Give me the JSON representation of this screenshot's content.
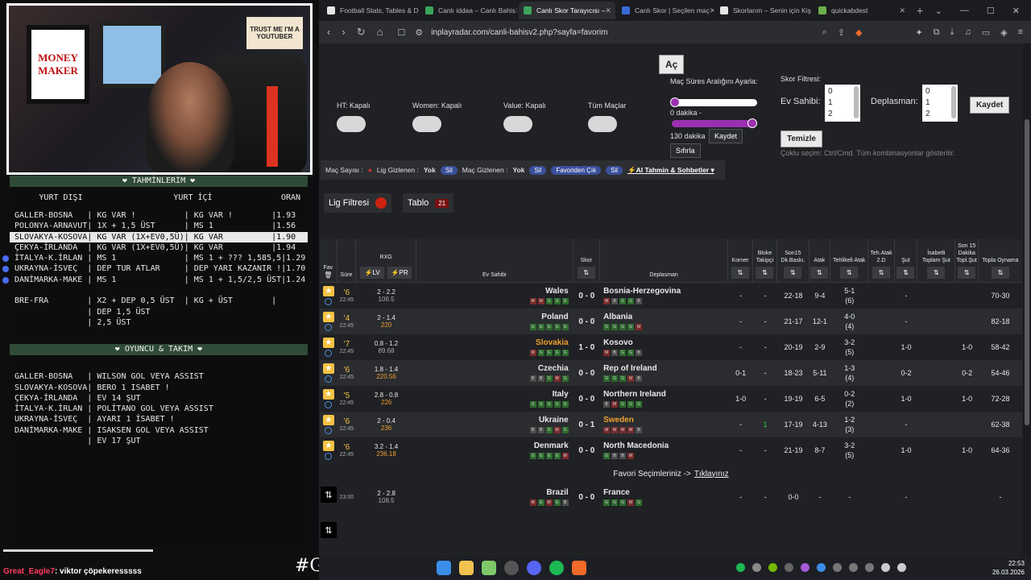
{
  "stream": {
    "poster_text": "MONEY MAKER",
    "sign_text": "TRUST ME I'M A YOUTUBER",
    "section1_title": "TAHMİNLERİM",
    "col_headers": [
      "YURT DIŞI",
      "YURT İÇİ",
      "ORAN"
    ],
    "predictions": [
      "GALLER-BOSNA   | KG VAR !          | KG VAR !        |1.93",
      "POLONYA-ARNAVUT| 1X + 1,5 ÜST      | MS 1            |1.56",
      "SLOVAKYA-KOSOVA| KG VAR (1X+EV0,5Ü)| KG VAR          |1.90",
      "ÇEKYA-İRLANDA  | KG VAR (1X+EV0,5Ü)| KG VAR          |1.94",
      "İTALYA-K.İRLAN | MS 1              | MS 1 + ??? 1,585,5|1.29",
      "UKRAYNA-İSVEÇ  | DEP TUR ATLAR     | DEP YARI KAZANIR !|1.70",
      "DANİMARKA-MAKE | MS 1              | MS 1 + 1,5/2,5 ÜST|1.24",
      "",
      "BRE-FRA        | X2 + DEP 0,5 ÜST  | KG + ÜST        |",
      "               | DEP 1,5 ÜST",
      "               | 2,5 ÜST"
    ],
    "section2_title": "OYUNCU & TAKIM",
    "player_props": [
      "GALLER-BOSNA   | WILSON GOL VEYA ASSIST",
      "SLOVAKYA-KOSOVA| BERO 1 ISABET !",
      "ÇEKYA-İRLANDA  | EV 14 ŞUT",
      "İTALYA-K.İRLAN | POLİTANO GOL VEYA ASSIST",
      "UKRAYNA-İSVEÇ  | AYARI 1 İSABET !",
      "DANİMARKA-MAKE | ISAKSEN GOL VEYA ASSIST",
      "               | EV 17 ŞUT"
    ],
    "chat_user": "Great_Eagle7",
    "chat_msg": ": viktor çöpekeresssss",
    "hashtag": "#GollerNerede"
  },
  "tabs": [
    {
      "label": "Football Stats, Tables & D",
      "color": "#e7e7e7"
    },
    {
      "label": "Canlı iddaa – Canlı Bahis",
      "color": "#3aa55a"
    },
    {
      "label": "Canlı Skor Tarayıcısı –",
      "color": "#3aa55a"
    },
    {
      "label": "Canlı Skor | Seçilen maç",
      "color": "#3a6ad8"
    },
    {
      "label": "Skorlarım – Senin için Kiş",
      "color": "#e7e7e7"
    },
    {
      "label": "quickabdest",
      "color": "#6ab04c"
    }
  ],
  "url": "inplayradar.com/canli-bahisv2.php?sayfa=favorim",
  "filters": {
    "ac_label": "Aç",
    "toggles": [
      "HT: Kapalı",
      "Women: Kapalı",
      "Value: Kapalı",
      "Tüm Maçlar"
    ],
    "duration_title": "Maç Süres Aralığını Ayarla:",
    "min_label": "0 dakika -",
    "max_label": "130 dakika",
    "kaydet": "Kaydet",
    "sifirla": "Sıfırla",
    "skor_filtresi": "Skor Filtresi:",
    "ev_sahibi": "Ev Sahibi:",
    "deplasman": "Deplasman:",
    "list_values": [
      "0",
      "1",
      "2"
    ],
    "kaydet2": "Kaydet",
    "temizle": "Temizle",
    "hint": "Çoklu seçim: Ctrl/Cmd. Tüm kombinasyonlar gösterilir."
  },
  "bar": {
    "mac_sayisi": "Maç Sayısı :",
    "lig_gizlenen": "Lig Gizlenen :",
    "yok1": "Yok",
    "sil1": "Sil",
    "mac_gizlenen": "Maç Gizlenen :",
    "yok2": "Yok",
    "sil2": "Sil",
    "favoriden": "Favoriden Çık",
    "sil3": "Sil",
    "ai": "AI Tahmin & Sohbetler"
  },
  "lig_filtresi": "Lig Filtresi",
  "tablo": "Tablo",
  "tablo_count": "21",
  "headers": {
    "fav": "Fav",
    "sure": "Süre",
    "rxg": "RXG",
    "lv": "LV",
    "pr": "PR",
    "ev": "Ev Sahibi",
    "skor": "Skor",
    "dep": "Deplasman",
    "korner": "Korner",
    "bloke": "Bloke Takipçi",
    "son15": "Son15 Dk.Baskı.",
    "atak": "Atak",
    "tehlikeli": "Tehlikeli Atak",
    "teh2d": "Teh.Atak 2.D",
    "sut": "Şut",
    "isabetli": "İsabetli Toplam Şut",
    "s15sut": "Son 15 Dakika Topl.Şut",
    "topla": "Topla Oynama"
  },
  "matches": [
    {
      "min": "6",
      "time": "22:45",
      "rxg": "2 - 2.2",
      "rxgv": "106.5",
      "home": "Wales",
      "score": "0 - 0",
      "away": "Bosnia-Herzegovina",
      "hform": "MMGGG",
      "aform": "MBGGB",
      "korner": "-",
      "bloke": "-",
      "son15": "22-18",
      "atak": "9-4",
      "tehl": "5-1",
      "tehl2": "(6)",
      "teh2d": "",
      "sut": "-",
      "isab": "",
      "s15": "",
      "top": "70-30"
    },
    {
      "min": "4",
      "time": "22:45",
      "rxg": "2 - 1.4",
      "rxgv": "220",
      "home": "Poland",
      "score": "0 - 0",
      "away": "Albania",
      "hform": "GGGGG",
      "aform": "GGGGM",
      "korner": "-",
      "bloke": "-",
      "son15": "21-17",
      "atak": "12-1",
      "tehl": "4-0",
      "tehl2": "(4)",
      "teh2d": "",
      "sut": "-",
      "isab": "",
      "s15": "",
      "top": "82-18"
    },
    {
      "min": "7",
      "time": "22:45",
      "rxg": "0.8 - 1.2",
      "rxgv": "89.68",
      "home": "Slovakia",
      "score": "1 - 0",
      "away": "Kosovo",
      "hform": "MGGGG",
      "aform": "MBGGB",
      "korner": "-",
      "bloke": "-",
      "son15": "20-19",
      "atak": "2-9",
      "tehl": "3-2",
      "tehl2": "(5)",
      "teh2d": "",
      "sut": "1-0",
      "isab": "",
      "s15": "1-0",
      "top": "58-42"
    },
    {
      "min": "6",
      "time": "22:45",
      "rxg": "1.8 - 1.4",
      "rxgv": "220.56",
      "home": "Czechia",
      "score": "0 - 0",
      "away": "Rep of Ireland",
      "hform": "BBGMG",
      "aform": "GGGMB",
      "korner": "0-1",
      "bloke": "-",
      "son15": "18-23",
      "atak": "5-11",
      "tehl": "1-3",
      "tehl2": "(4)",
      "teh2d": "",
      "sut": "0-2",
      "isab": "",
      "s15": "0-2",
      "top": "54-46"
    },
    {
      "min": "5",
      "time": "22:45",
      "rxg": "2.8 - 0.8",
      "rxgv": "226",
      "home": "Italy",
      "score": "0 - 0",
      "away": "Northern Ireland",
      "hform": "GGGGG",
      "aform": "BMGGG",
      "korner": "1-0",
      "bloke": "-",
      "son15": "19-19",
      "atak": "6-5",
      "tehl": "0-2",
      "tehl2": "(2)",
      "teh2d": "",
      "sut": "1-0",
      "isab": "",
      "s15": "1-0",
      "top": "72-28"
    },
    {
      "min": "6",
      "time": "22:45",
      "rxg": "2 - 0.4",
      "rxgv": "236",
      "home": "Ukraine",
      "score": "0 - 1",
      "away": "Sweden",
      "hform": "BBGMG",
      "aform": "MMMMB",
      "korner": "-",
      "bloke": "1",
      "son15": "17-19",
      "atak": "4-13",
      "tehl": "1-2",
      "tehl2": "(3)",
      "teh2d": "",
      "sut": "-",
      "isab": "",
      "s15": "",
      "top": "62-38"
    },
    {
      "min": "6",
      "time": "22:45",
      "rxg": "3.2 - 1.4",
      "rxgv": "236.18",
      "home": "Denmark",
      "score": "0 - 0",
      "away": "North Macedonia",
      "hform": "GGGGM",
      "aform": "GBBM",
      "korner": "-",
      "bloke": "-",
      "son15": "21-19",
      "atak": "8-7",
      "tehl": "3-2",
      "tehl2": "(5)",
      "teh2d": "",
      "sut": "1-0",
      "isab": "",
      "s15": "1-0",
      "top": "64-36"
    }
  ],
  "fav_line": "Favori Seçimleriniz ->",
  "fav_link": "Tıklayınız",
  "extra_match": {
    "time": "23:00",
    "rxg": "2 - 2.8",
    "rxgv": "108.5",
    "home": "Brazil",
    "score": "0 - 0",
    "away": "France",
    "hform": "MGMGB",
    "aform": "GGGMG",
    "korner": "-",
    "bloke": "-",
    "son15": "0-0",
    "atak": "-",
    "tehl": "-",
    "sut": "-",
    "top": "-"
  },
  "clock": {
    "time": "22:53",
    "date": "26.03.2026"
  },
  "colors": {
    "accent": "#9b30b0",
    "star": "#f5c242",
    "link_orange": "#f0a030"
  }
}
